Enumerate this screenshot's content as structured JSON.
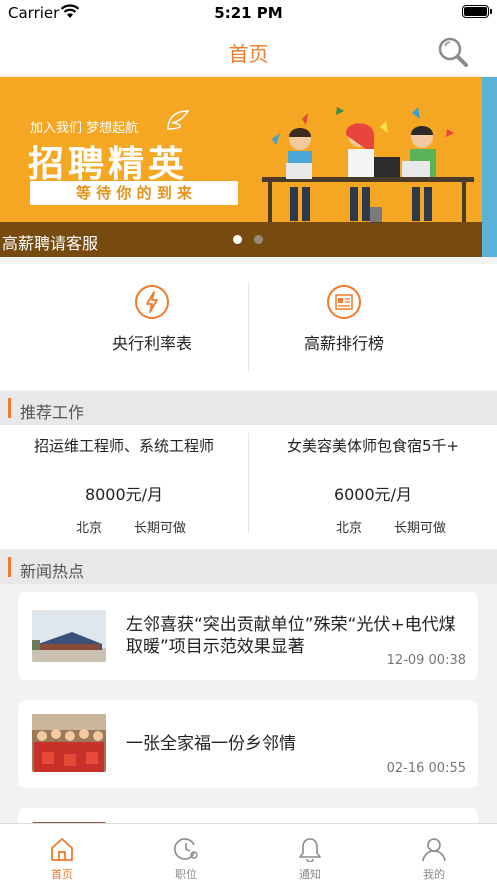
{
  "status_bar": {
    "carrier": "Carrier",
    "time": "5:21 PM"
  },
  "header": {
    "title": "首页"
  },
  "banner": {
    "slogan": "加入我们 梦想起航",
    "headline": "招聘精英",
    "sub_headline": "等 待 你 的 到 来",
    "caption": "高薪聘请客服",
    "active_page": 1,
    "page_count": 2
  },
  "quick_links": [
    {
      "label": "央行利率表",
      "icon": "lightning-icon"
    },
    {
      "label": "高薪排行榜",
      "icon": "newspaper-icon"
    }
  ],
  "recommended": {
    "section_title": "推荐工作",
    "jobs": [
      {
        "title": "招运维工程师、系统工程师",
        "salary": "8000元/月",
        "city": "北京",
        "term": "长期可做"
      },
      {
        "title": "女美容美体师包食宿5千+",
        "salary": "6000元/月",
        "city": "北京",
        "term": "长期可做"
      }
    ]
  },
  "news": {
    "section_title": "新闻热点",
    "items": [
      {
        "title": "左邻喜获“突出贡献单位”殊荣“光伏+电代煤取暖”项目示范效果显著",
        "time": "12-09 00:38"
      },
      {
        "title": "一张全家福一份乡邻情",
        "time": "02-16 00:55"
      }
    ]
  },
  "tab_bar": {
    "tabs": [
      {
        "label": "首页",
        "icon": "home-icon",
        "active": true
      },
      {
        "label": "职位",
        "icon": "clock-icon",
        "active": false
      },
      {
        "label": "通知",
        "icon": "bell-icon",
        "active": false
      },
      {
        "label": "我的",
        "icon": "user-icon",
        "active": false
      }
    ]
  },
  "colors": {
    "accent": "#f07a2b",
    "banner": "#f5a623",
    "inactive": "#8a8a8a"
  }
}
